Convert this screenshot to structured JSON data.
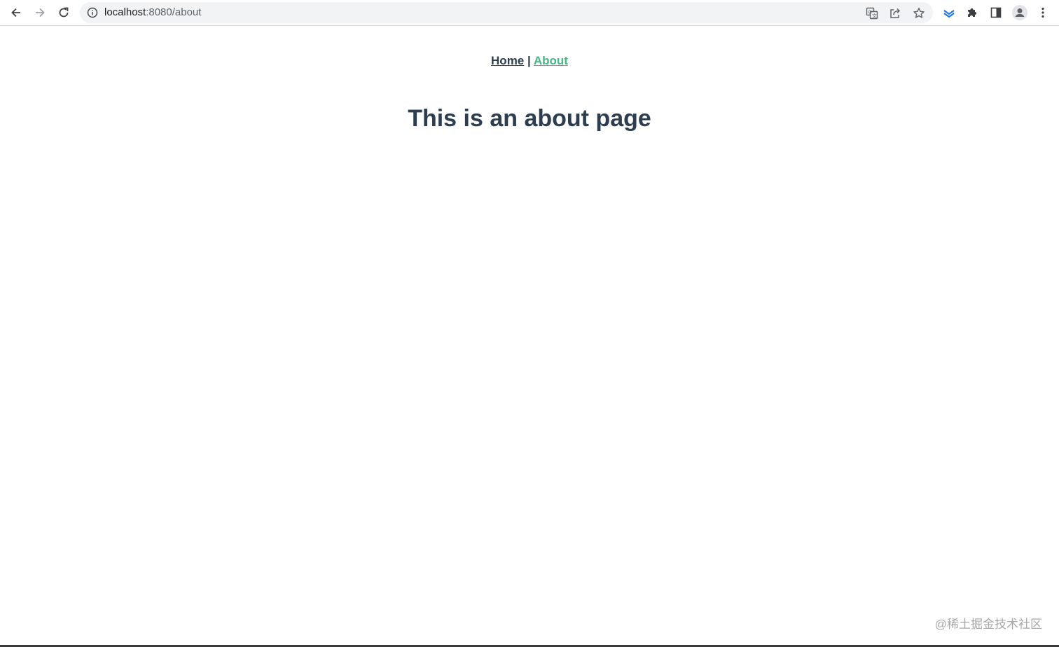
{
  "browser": {
    "url_host": "localhost",
    "url_rest": ":8080/about"
  },
  "nav": {
    "home_label": "Home",
    "separator": "|",
    "about_label": "About"
  },
  "page": {
    "heading": "This is an about page"
  },
  "watermark": "@稀土掘金技术社区",
  "colors": {
    "text": "#2c3e50",
    "active_link": "#42b983"
  },
  "icons": [
    "back-arrow-icon",
    "forward-arrow-icon",
    "reload-icon",
    "info-icon",
    "translate-icon",
    "share-icon",
    "star-icon",
    "extension-layers-icon",
    "puzzle-icon",
    "side-panel-icon",
    "profile-icon",
    "menu-dots-icon"
  ]
}
